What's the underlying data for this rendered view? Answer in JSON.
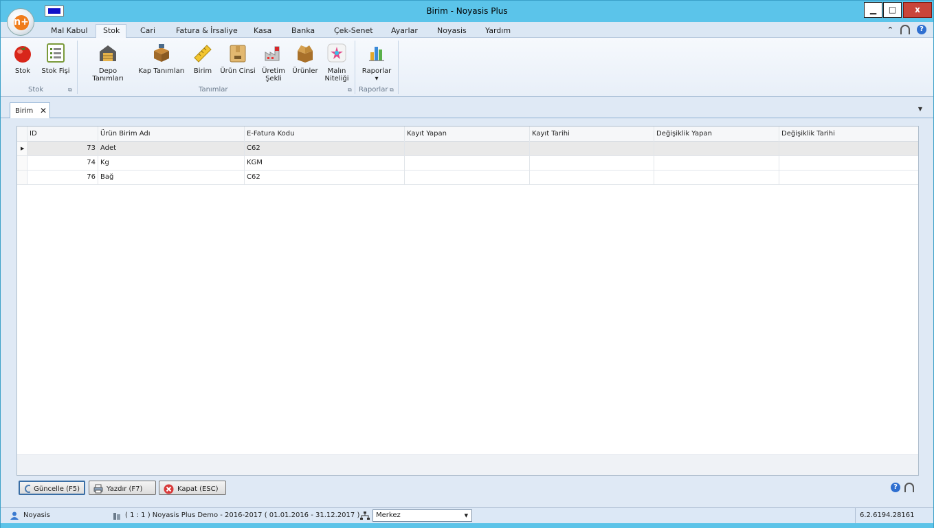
{
  "window": {
    "title": "Birim - Noyasis Plus"
  },
  "app_logo": {
    "glyph": "n+"
  },
  "window_controls": {
    "minimize": "▁",
    "maximize": "□",
    "close": "x"
  },
  "ribbon_tabs": [
    "Mal Kabul",
    "Stok",
    "Cari",
    "Fatura & İrsaliye",
    "Kasa",
    "Banka",
    "Çek-Senet",
    "Ayarlar",
    "Noyasis",
    "Yardım"
  ],
  "ribbon_tab_active": "Stok",
  "ribbon": {
    "stok": {
      "label": "Stok"
    },
    "stok_fisi": {
      "label": "Stok Fişi"
    },
    "depo": {
      "label": "Depo Tanımları"
    },
    "kap": {
      "label": "Kap Tanımları"
    },
    "birim": {
      "label": "Birim"
    },
    "urun_cinsi": {
      "label": "Ürün Cinsi"
    },
    "uretim_sekli": {
      "line1": "Üretim",
      "line2": "Şekli"
    },
    "urunler": {
      "label": "Ürünler"
    },
    "malin_niteligi": {
      "line1": "Malın",
      "line2": "Niteliği"
    },
    "raporlar": {
      "label": "Raporlar",
      "arrow": "▾"
    },
    "groups": {
      "stok": "Stok",
      "tanimlar": "Tanımlar",
      "raporlar": "Raporlar"
    }
  },
  "doc_tab": {
    "label": "Birim",
    "close": "✕"
  },
  "grid": {
    "columns": [
      "ID",
      "Ürün Birim Adı",
      "E-Fatura Kodu",
      "Kayıt Yapan",
      "Kayıt Tarihi",
      "Değişiklik Yapan",
      "Değişiklik Tarihi"
    ],
    "rows": [
      {
        "id": "73",
        "name": "Adet",
        "efatura": "C62",
        "kayit_yapan": "",
        "kayit_tarihi": "",
        "degisiklik_yapan": "",
        "degisiklik_tarihi": ""
      },
      {
        "id": "74",
        "name": "Kg",
        "efatura": "KGM",
        "kayit_yapan": "",
        "kayit_tarihi": "",
        "degisiklik_yapan": "",
        "degisiklik_tarihi": ""
      },
      {
        "id": "76",
        "name": "Bağ",
        "efatura": "C62",
        "kayit_yapan": "",
        "kayit_tarihi": "",
        "degisiklik_yapan": "",
        "degisiklik_tarihi": ""
      }
    ]
  },
  "buttons": {
    "refresh": "Güncelle (F5)",
    "print": "Yazdır (F7)",
    "close": "Kapat (ESC)"
  },
  "status": {
    "user": "Noyasis",
    "company": "( 1 : 1 )  Noyasis Plus Demo - 2016-2017  ( 01.01.2016 - 31.12.2017 )",
    "branch": "Merkez",
    "version": "6.2.6194.28161"
  },
  "colors": {
    "titlebar": "#5bc4ea",
    "ribbon": "#e8eff8",
    "accent": "#3a6ea5"
  }
}
